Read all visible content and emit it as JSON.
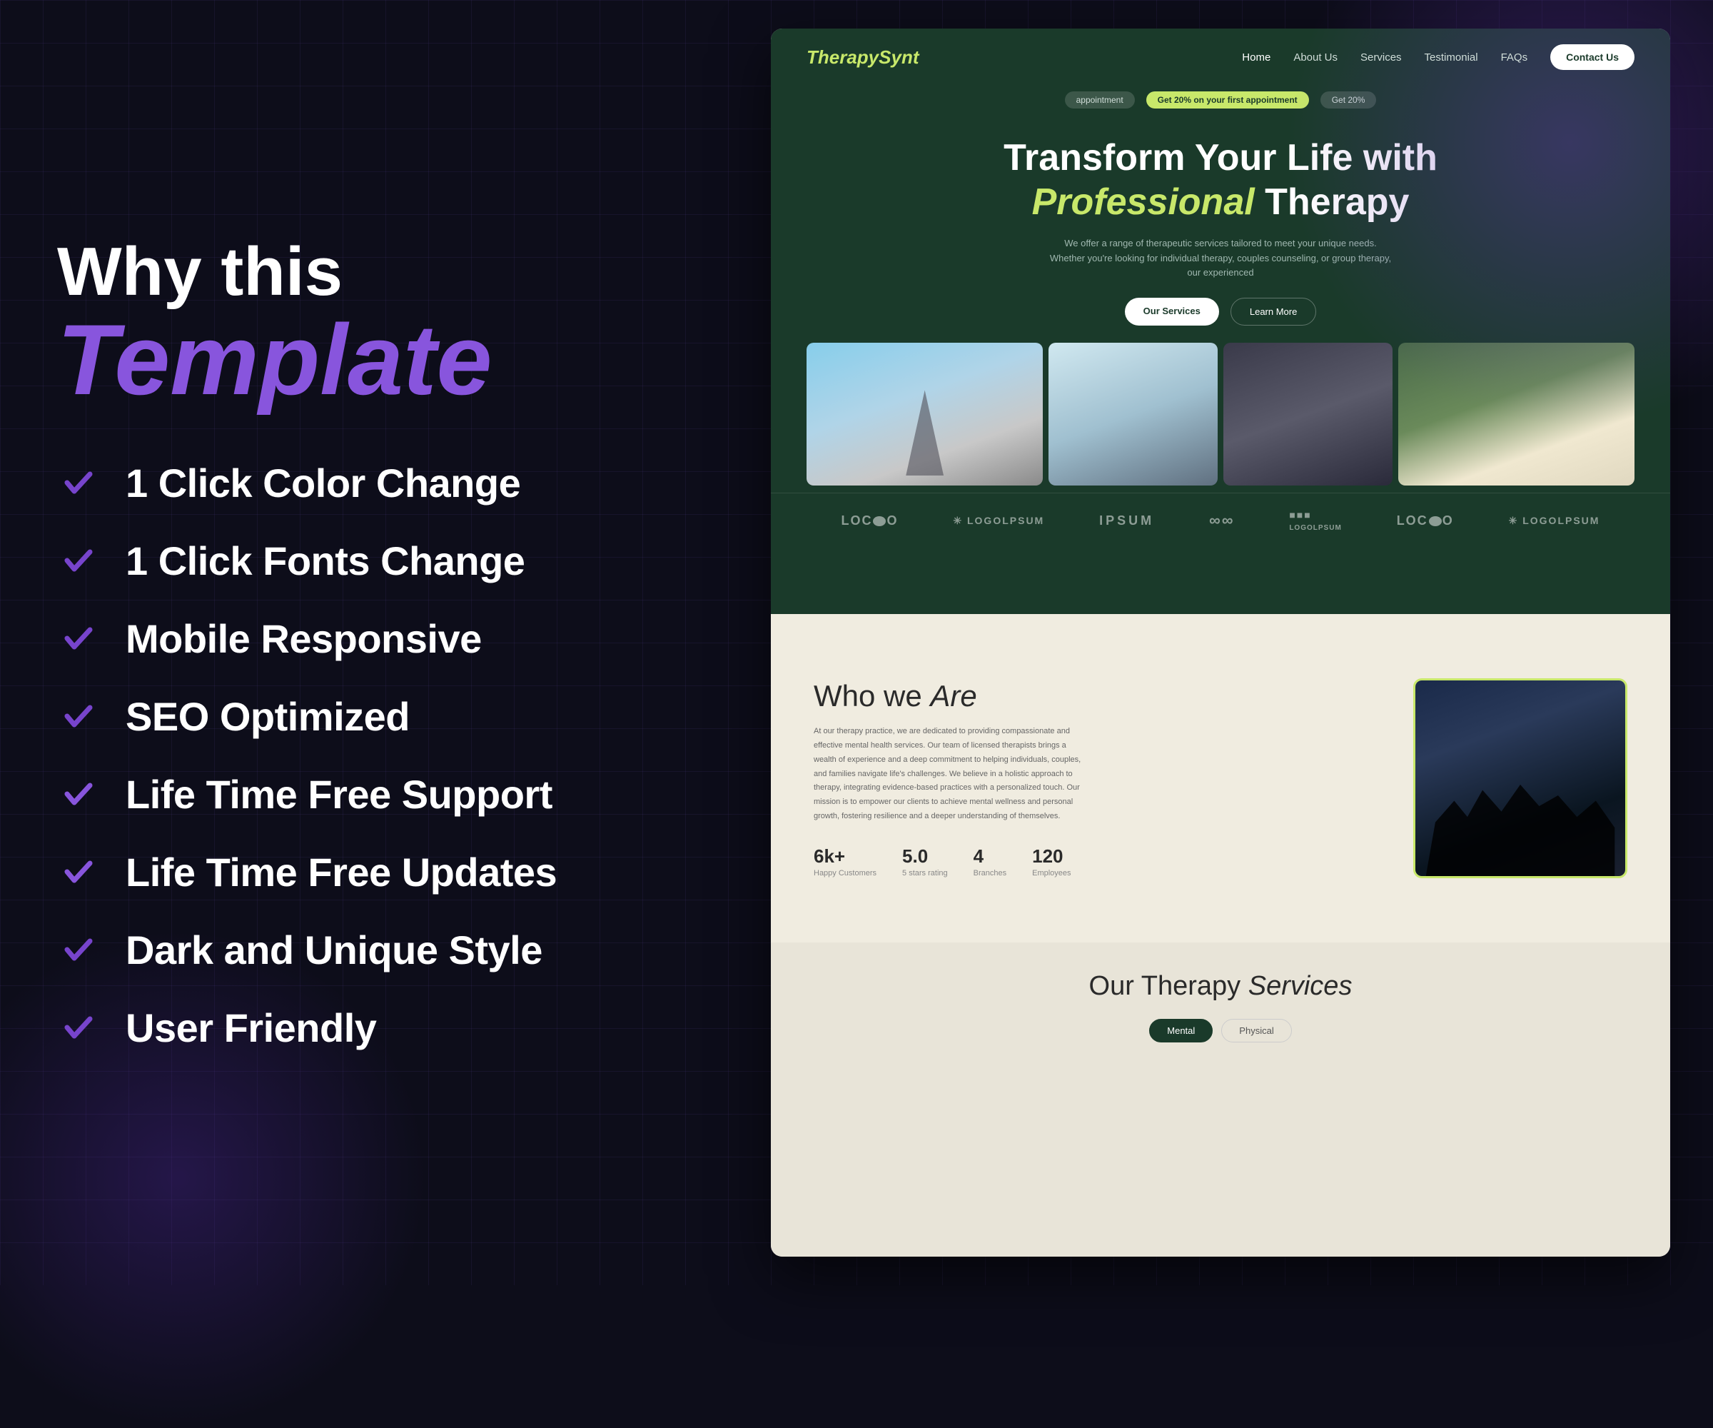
{
  "left": {
    "why_text": "Why this",
    "template_text": "Template",
    "features": [
      {
        "text": "1 Click Color Change",
        "id": "color-change"
      },
      {
        "text": "1 Click Fonts Change",
        "id": "fonts-change"
      },
      {
        "text": "Mobile Responsive",
        "id": "mobile-responsive"
      },
      {
        "text": "SEO Optimized",
        "id": "seo-optimized"
      },
      {
        "text": "Life Time Free Support",
        "id": "lifetime-support"
      },
      {
        "text": "Life Time Free Updates",
        "id": "lifetime-updates"
      },
      {
        "text": "Dark and Unique Style",
        "id": "dark-unique"
      },
      {
        "text": "User Friendly",
        "id": "user-friendly"
      }
    ]
  },
  "website": {
    "nav": {
      "logo": "TherapySynt",
      "links": [
        "Home",
        "About Us",
        "Services",
        "Testimonial",
        "FAQs"
      ],
      "contact_btn": "Contact Us"
    },
    "announce": {
      "pill1": "appointment",
      "pill2": "Get 20% on your first appointment",
      "pill3": "Get 20%"
    },
    "hero": {
      "title_line1": "Transform Your Life with",
      "title_line2_plain": "",
      "title_italic": "Professional",
      "title_line2_rest": " Therapy",
      "subtitle": "We offer a range of therapeutic services tailored to meet your unique needs. Whether you're looking for individual therapy, couples counseling, or group therapy, our experienced",
      "btn_primary": "Our Services",
      "btn_secondary": "Learn More"
    },
    "logos": [
      "LOGO",
      "Logolpsum",
      "IPSUM",
      "∞∞",
      "logolpsum",
      "LOGO",
      "Logolpsum"
    ],
    "about": {
      "heading_plain": "Who we ",
      "heading_italic": "Are",
      "body": "At our therapy practice, we are dedicated to providing compassionate and effective mental health services. Our team of licensed therapists brings a wealth of experience and a deep commitment to helping individuals, couples, and families navigate life's challenges. We believe in a holistic approach to therapy, integrating evidence-based practices with a personalized touch. Our mission is to empower our clients to achieve mental wellness and personal growth, fostering resilience and a deeper understanding of themselves.",
      "stats": [
        {
          "number": "6k+",
          "label": "Happy Customers"
        },
        {
          "number": "5.0",
          "label": "5 stars rating"
        },
        {
          "number": "4",
          "label": "Branches"
        },
        {
          "number": "120",
          "label": "Employees"
        }
      ]
    },
    "services": {
      "heading_plain": "Our Therapy ",
      "heading_italic": "Services",
      "tabs": [
        "Mental",
        "Physical"
      ]
    }
  },
  "colors": {
    "accent_purple": "#8855dd",
    "accent_green": "#c8e86a",
    "hero_bg": "#1a3a2a",
    "cream_bg": "#f0ece0"
  }
}
